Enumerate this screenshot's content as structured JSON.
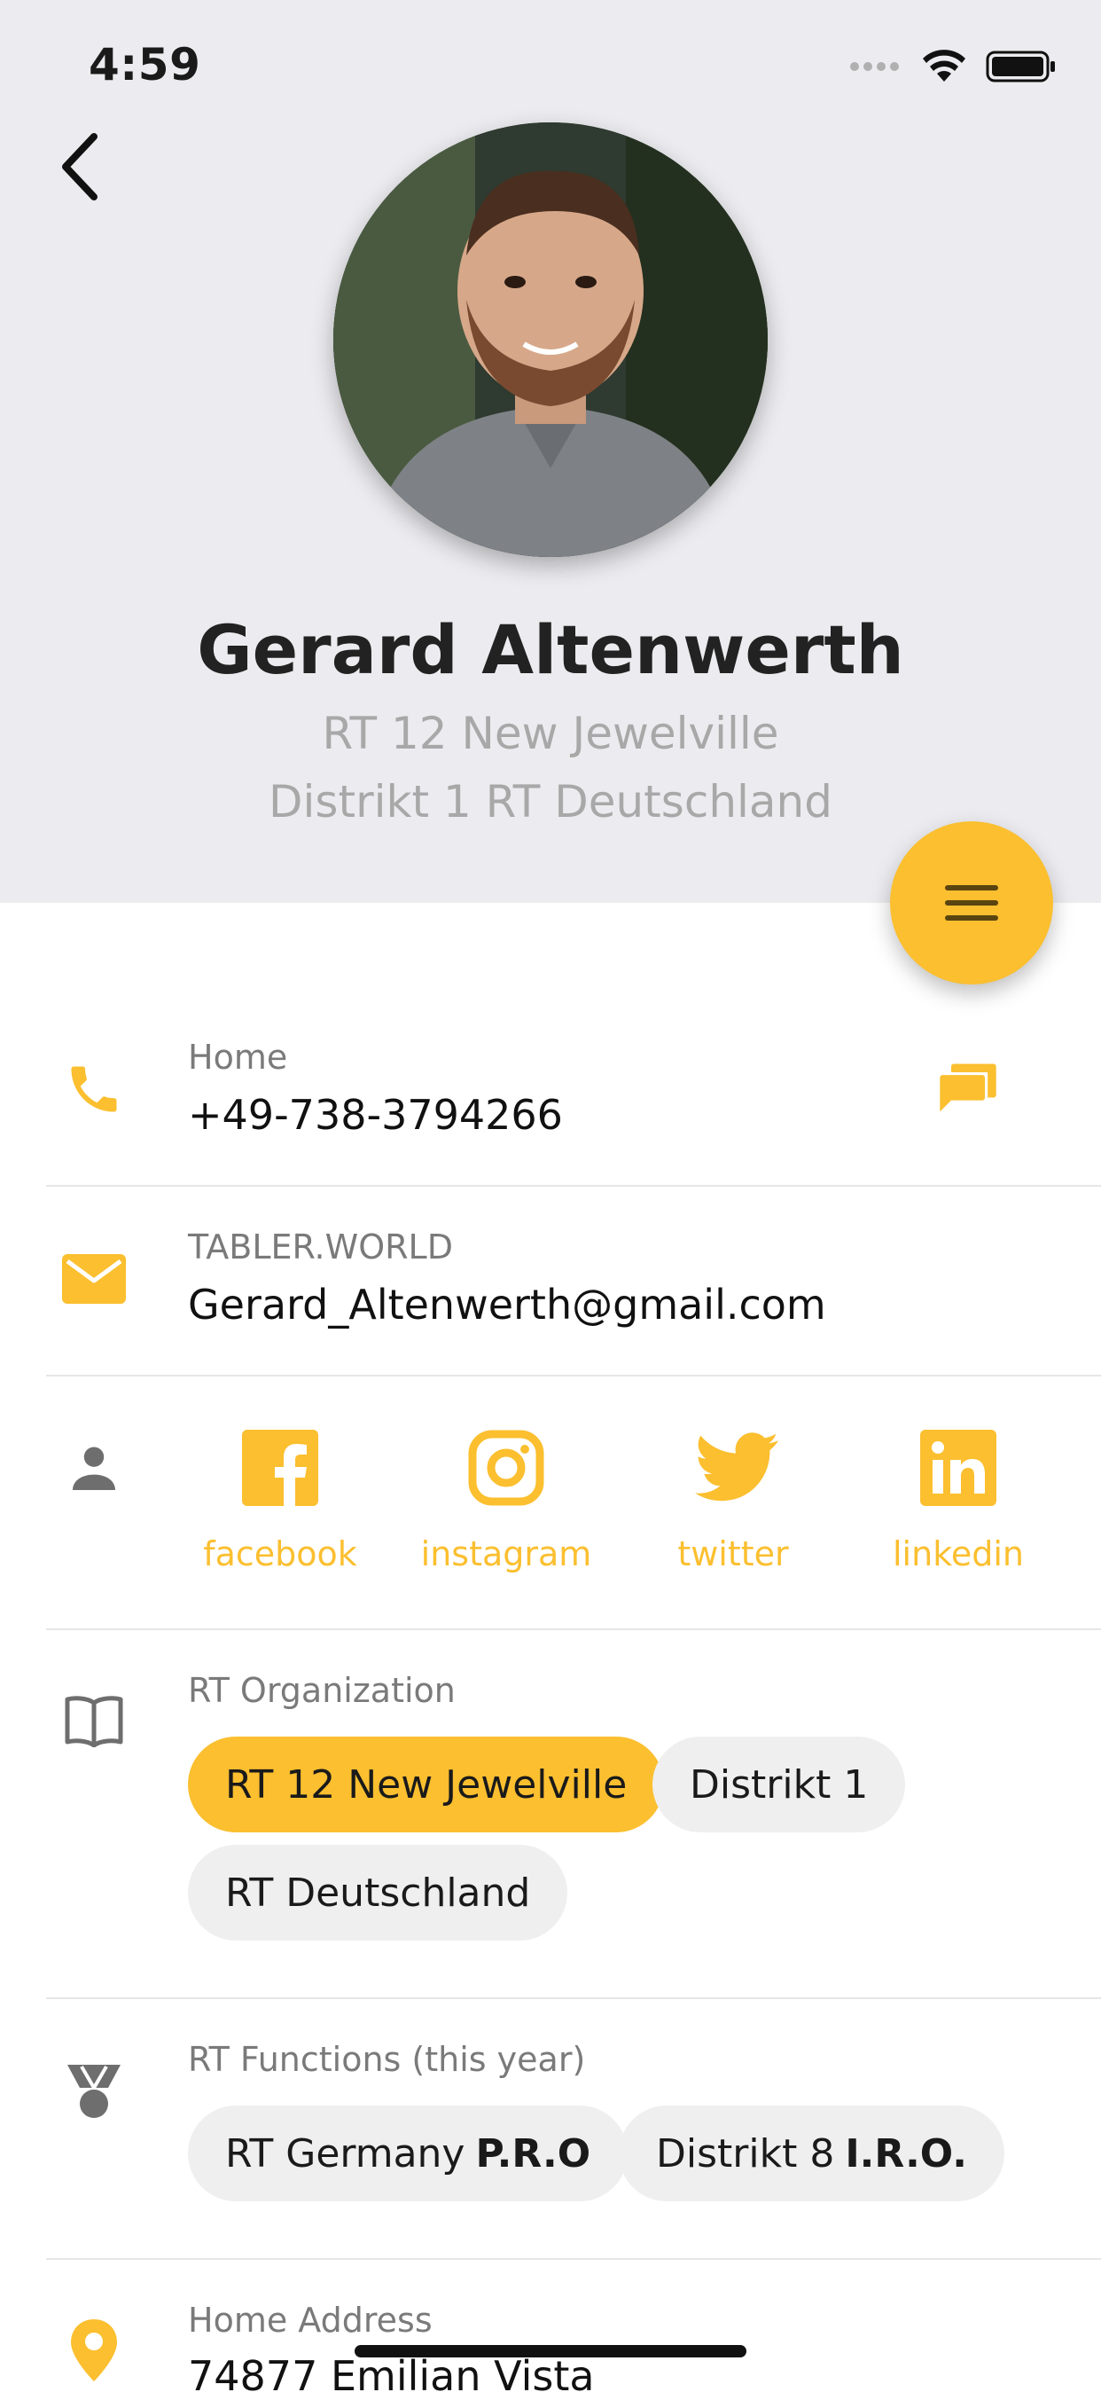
{
  "status_bar": {
    "time": "4:59"
  },
  "profile": {
    "name": "Gerard Altenwerth",
    "subtitle_line1": "RT 12 New Jewelville",
    "subtitle_line2": "Distrikt 1 RT Deutschland"
  },
  "contact": {
    "phone": {
      "label": "Home",
      "value": "+49-738-3794266",
      "icon": "phone-icon"
    },
    "email": {
      "label": "TABLER.WORLD",
      "value": "Gerard_Altenwerth@gmail.com",
      "icon": "mail-icon"
    }
  },
  "social": [
    {
      "label": "facebook",
      "icon": "facebook-icon"
    },
    {
      "label": "instagram",
      "icon": "instagram-icon"
    },
    {
      "label": "twitter",
      "icon": "twitter-icon"
    },
    {
      "label": "linkedin",
      "icon": "linkedin-icon"
    }
  ],
  "organization": {
    "label": "RT Organization",
    "chips": [
      "RT 12 New Jewelville",
      "Distrikt 1",
      "RT Deutschland"
    ]
  },
  "functions": {
    "label": "RT Functions (this year)",
    "chips": [
      {
        "prefix": "RT Germany",
        "role": "P.R.O"
      },
      {
        "prefix": "Distrikt 8",
        "role": "I.R.O."
      }
    ]
  },
  "address": {
    "label": "Home Address",
    "value": "74877 Emilian Vista"
  },
  "colors": {
    "accent": "#fbbf2f",
    "header_bg": "#ececf0",
    "icon_gray": "#6e6e6e"
  }
}
